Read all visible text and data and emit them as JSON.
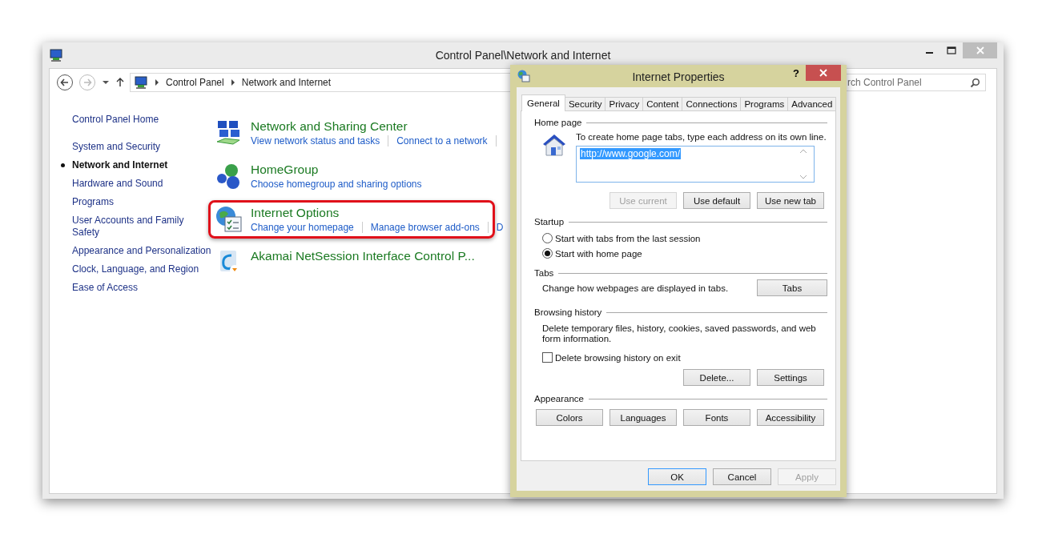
{
  "window": {
    "title": "Control Panel\\Network and Internet"
  },
  "address_bar": {
    "crumbs": [
      "Control Panel",
      "Network and Internet"
    ]
  },
  "search": {
    "placeholder": "rch Control Panel"
  },
  "sidebar": {
    "home": "Control Panel Home",
    "items": [
      {
        "label": "System and Security",
        "selected": false
      },
      {
        "label": "Network and Internet",
        "selected": true
      },
      {
        "label": "Hardware and Sound",
        "selected": false
      },
      {
        "label": "Programs",
        "selected": false
      },
      {
        "label": "User Accounts and Family Safety",
        "selected": false
      },
      {
        "label": "Appearance and Personalization",
        "selected": false
      },
      {
        "label": "Clock, Language, and Region",
        "selected": false
      },
      {
        "label": "Ease of Access",
        "selected": false
      }
    ]
  },
  "categories": [
    {
      "kind": "network",
      "title": "Network and Sharing Center",
      "links": [
        "View network status and tasks",
        "Connect to a network"
      ],
      "more": true,
      "highlighted": false
    },
    {
      "kind": "homegroup",
      "title": "HomeGroup",
      "links": [
        "Choose homegroup and sharing options"
      ],
      "more": false,
      "highlighted": false
    },
    {
      "kind": "internet",
      "title": "Internet Options",
      "links": [
        "Change your homepage",
        "Manage browser add-ons",
        "D"
      ],
      "more": false,
      "highlighted": true
    },
    {
      "kind": "akamai",
      "title": "Akamai NetSession Interface Control P...",
      "highlighted": false
    }
  ],
  "dialog": {
    "title": "Internet Properties",
    "help": "?",
    "tabs": [
      {
        "label": "General",
        "selected": true
      },
      {
        "label": "Security",
        "selected": false
      },
      {
        "label": "Privacy",
        "selected": false
      },
      {
        "label": "Content",
        "selected": false
      },
      {
        "label": "Connections",
        "selected": false
      },
      {
        "label": "Programs",
        "selected": false
      },
      {
        "label": "Advanced",
        "selected": false
      }
    ],
    "home_page": {
      "heading": "Home page",
      "hint": "To create home page tabs, type each address on its own line.",
      "value": "http://www.google.com/",
      "value_selected": true,
      "buttons": [
        {
          "label": "Use current",
          "disabled": true
        },
        {
          "label": "Use default",
          "disabled": false
        },
        {
          "label": "Use new tab",
          "disabled": false
        }
      ]
    },
    "startup": {
      "heading": "Startup",
      "options": [
        {
          "label": "Start with tabs from the last session",
          "selected": false
        },
        {
          "label": "Start with home page",
          "selected": true
        }
      ]
    },
    "tabs_section": {
      "heading": "Tabs",
      "text": "Change how webpages are displayed in tabs.",
      "button": "Tabs"
    },
    "history": {
      "heading": "Browsing history",
      "text": "Delete temporary files, history, cookies, saved passwords, and web form information.",
      "checkbox": {
        "label": "Delete browsing history on exit",
        "checked": false
      },
      "buttons": [
        {
          "label": "Delete...",
          "disabled": false
        },
        {
          "label": "Settings",
          "disabled": false
        }
      ]
    },
    "appearance": {
      "heading": "Appearance",
      "buttons": [
        {
          "label": "Colors",
          "disabled": false
        },
        {
          "label": "Languages",
          "disabled": false
        },
        {
          "label": "Fonts",
          "disabled": false
        },
        {
          "label": "Accessibility",
          "disabled": false
        }
      ]
    },
    "footer": [
      {
        "label": "OK",
        "disabled": false,
        "default": true
      },
      {
        "label": "Cancel",
        "disabled": false,
        "default": false
      },
      {
        "label": "Apply",
        "disabled": true,
        "default": false
      }
    ]
  }
}
